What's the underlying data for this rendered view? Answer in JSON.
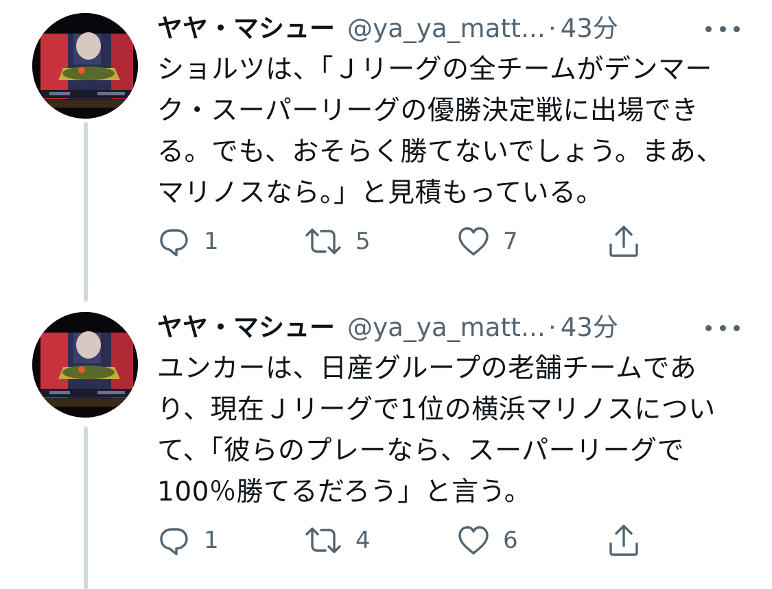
{
  "tweets": [
    {
      "display_name": "ヤヤ・マシュー",
      "handle": "@ya_ya_matt...",
      "separator": "·",
      "time": "43分",
      "text": "ショルツは、「Ｊリーグの全チームがデンマーク・スーパーリーグの優勝決定戦に出場できる。でも、おそらく勝てないでしょう。まあ、マリノスなら。」と見積もっている。",
      "replies": "1",
      "retweets": "5",
      "likes": "7"
    },
    {
      "display_name": "ヤヤ・マシュー",
      "handle": "@ya_ya_matt...",
      "separator": "·",
      "time": "43分",
      "text": "ユンカーは、日産グループの老舗チームであり、現在Ｊリーグで1位の横浜マリノスについて、「彼らのプレーなら、スーパーリーグで100％勝てるだろう」と言う。",
      "replies": "1",
      "retweets": "4",
      "likes": "6"
    }
  ],
  "icons": {
    "avatar": "avatar-image",
    "more": "more-options-icon",
    "reply": "reply-icon",
    "retweet": "retweet-icon",
    "like": "like-icon",
    "share": "share-icon"
  },
  "colors": {
    "text": "#0f1419",
    "secondary": "#536471",
    "thread_line": "#cfd9de"
  }
}
